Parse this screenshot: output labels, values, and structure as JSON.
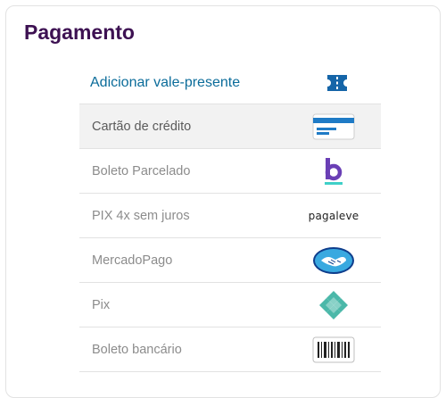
{
  "title": "Pagamento",
  "gift": {
    "label": "Adicionar vale-presente",
    "icon": "ticket-icon"
  },
  "methods": [
    {
      "label": "Cartão de crédito",
      "icon": "credit-card-icon",
      "selected": true
    },
    {
      "label": "Boleto Parcelado",
      "icon": "boleto-parcelado-b-icon"
    },
    {
      "label": "PIX 4x sem juros",
      "icon": "pagaleve-logo",
      "logo_text": "pagaleve"
    },
    {
      "label": "MercadoPago",
      "icon": "mercadopago-handshake-icon"
    },
    {
      "label": "Pix",
      "icon": "pix-icon"
    },
    {
      "label": "Boleto bancário",
      "icon": "barcode-icon"
    }
  ],
  "colors": {
    "title": "#3d1152",
    "link": "#0b6c9a",
    "selected_bg": "#f2f2f2"
  }
}
